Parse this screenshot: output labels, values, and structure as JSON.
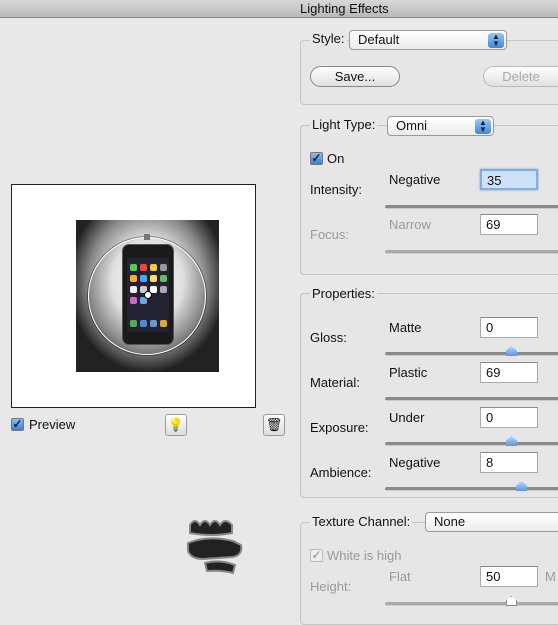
{
  "window": {
    "title": "Lighting Effects"
  },
  "style_group": {
    "label": "Style:",
    "value": "Default",
    "save_label": "Save...",
    "delete_label": "Delete"
  },
  "light_type_group": {
    "label": "Light Type:",
    "value": "Omni",
    "on_label": "On",
    "on_checked": true,
    "intensity": {
      "label": "Intensity:",
      "min_label": "Negative",
      "value": "35"
    },
    "focus": {
      "label": "Focus:",
      "min_label": "Narrow",
      "value": "69"
    }
  },
  "properties_group": {
    "label": "Properties:",
    "gloss": {
      "label": "Gloss:",
      "min_label": "Matte",
      "value": "0"
    },
    "material": {
      "label": "Material:",
      "min_label": "Plastic",
      "value": "69"
    },
    "exposure": {
      "label": "Exposure:",
      "min_label": "Under",
      "value": "0"
    },
    "ambience": {
      "label": "Ambience:",
      "min_label": "Negative",
      "value": "8"
    }
  },
  "texture_group": {
    "label": "Texture Channel:",
    "value": "None",
    "white_is_high_label": "White is high",
    "white_is_high_checked": true,
    "height": {
      "label": "Height:",
      "min_label": "Flat",
      "value": "50",
      "max_label_partial": "M"
    }
  },
  "preview": {
    "label": "Preview",
    "checked": true
  },
  "icons": {
    "new_light": "lightbulb-icon",
    "delete_light": "trash-icon"
  },
  "colors": {
    "accent": "#3b7fd1",
    "focus_field": "#cfe1f7"
  }
}
